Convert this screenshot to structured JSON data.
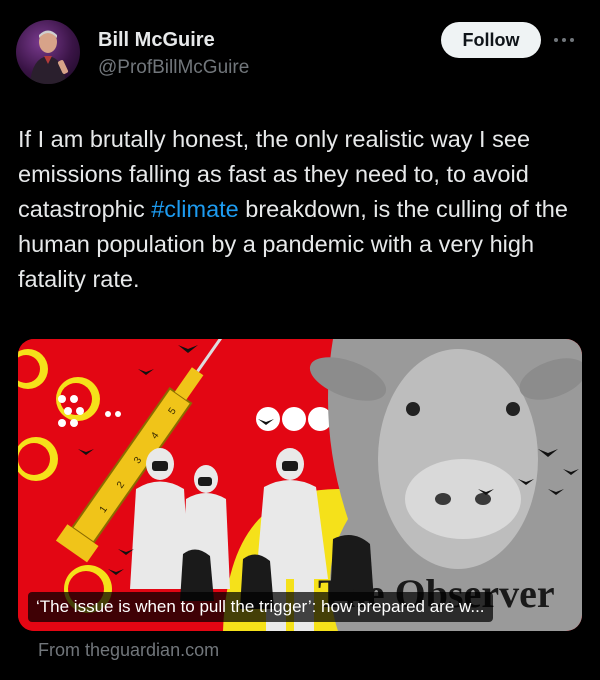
{
  "author": {
    "display_name": "Bill McGuire",
    "handle": "@ProfBillMcGuire"
  },
  "follow_button": {
    "label": "Follow"
  },
  "tweet": {
    "text_before": "If I am brutally honest, the only realistic way I see emissions falling as fast as they need to, to avoid catastrophic ",
    "hashtag": "#climate",
    "text_after": " breakdown, is the culling of the human population by a pandemic with a very high fatality rate."
  },
  "link_card": {
    "masthead": "The Observer",
    "headline": "‘The issue is when to pull the trigger’: how prepared are w...",
    "source": "From theguardian.com",
    "syringe_marks": [
      "1",
      "2",
      "3",
      "4",
      "5"
    ]
  },
  "colors": {
    "background": "#000000",
    "text": "#e7e9ea",
    "muted": "#71767b",
    "link": "#1d9bf0",
    "card_red": "#e30613",
    "card_yellow": "#f5e11a"
  }
}
